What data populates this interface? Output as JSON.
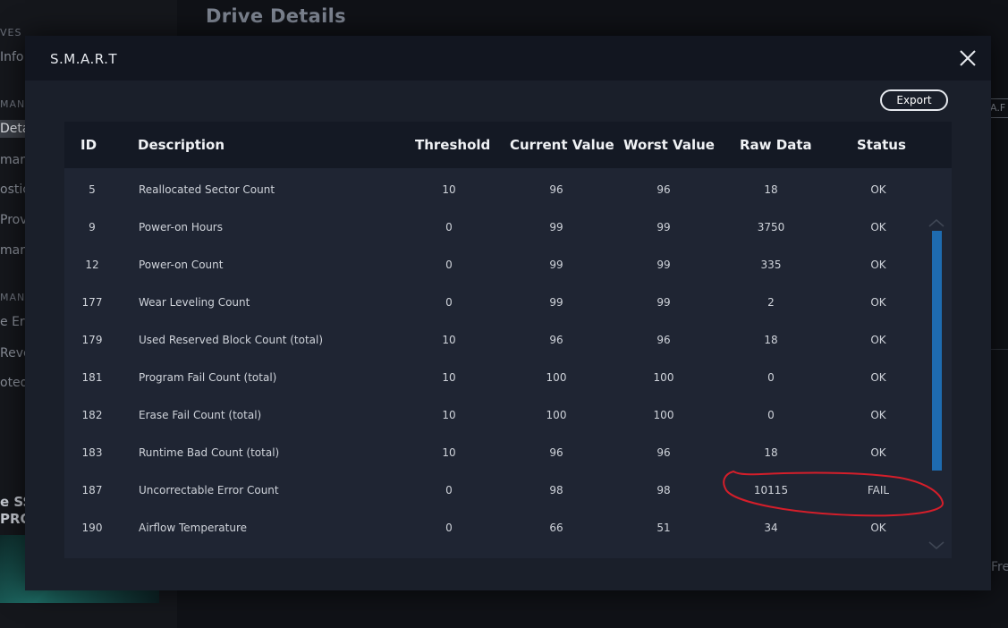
{
  "background": {
    "page_title": "Drive Details",
    "sidebar": {
      "fragments": [
        "VES",
        "Info",
        "MANA",
        "Deta",
        "mar",
        "ostic",
        "Prov",
        "mar",
        "MANA",
        "e Era",
        "Reve",
        "oted"
      ],
      "product_lines": [
        "e SS",
        "PRO"
      ]
    },
    "right_fragments": {
      "tab": "A.F",
      "text": "Fre"
    }
  },
  "modal": {
    "title": "S.M.A.R.T",
    "export_label": "Export",
    "columns": {
      "id": "ID",
      "description": "Description",
      "threshold": "Threshold",
      "current": "Current Value",
      "worst": "Worst Value",
      "raw": "Raw Data",
      "status": "Status"
    },
    "rows": [
      {
        "id": "5",
        "description": "Reallocated Sector Count",
        "threshold": "10",
        "current": "96",
        "worst": "96",
        "raw": "18",
        "status": "OK"
      },
      {
        "id": "9",
        "description": "Power-on Hours",
        "threshold": "0",
        "current": "99",
        "worst": "99",
        "raw": "3750",
        "status": "OK"
      },
      {
        "id": "12",
        "description": "Power-on Count",
        "threshold": "0",
        "current": "99",
        "worst": "99",
        "raw": "335",
        "status": "OK"
      },
      {
        "id": "177",
        "description": "Wear Leveling Count",
        "threshold": "0",
        "current": "99",
        "worst": "99",
        "raw": "2",
        "status": "OK"
      },
      {
        "id": "179",
        "description": "Used Reserved Block Count (total)",
        "threshold": "10",
        "current": "96",
        "worst": "96",
        "raw": "18",
        "status": "OK"
      },
      {
        "id": "181",
        "description": "Program Fail Count (total)",
        "threshold": "10",
        "current": "100",
        "worst": "100",
        "raw": "0",
        "status": "OK"
      },
      {
        "id": "182",
        "description": "Erase Fail Count (total)",
        "threshold": "10",
        "current": "100",
        "worst": "100",
        "raw": "0",
        "status": "OK"
      },
      {
        "id": "183",
        "description": "Runtime Bad Count (total)",
        "threshold": "10",
        "current": "96",
        "worst": "96",
        "raw": "18",
        "status": "OK"
      },
      {
        "id": "187",
        "description": "Uncorrectable Error Count",
        "threshold": "0",
        "current": "98",
        "worst": "98",
        "raw": "10115",
        "status": "FAIL"
      },
      {
        "id": "190",
        "description": "Airflow Temperature",
        "threshold": "0",
        "current": "66",
        "worst": "51",
        "raw": "34",
        "status": "OK"
      }
    ]
  },
  "colors": {
    "modal_bg": "#1a1f2a",
    "header_bg": "#121620",
    "scrollbar": "#1e6bb0",
    "annotation": "#d41e2a"
  },
  "icons": [
    "close-icon",
    "chevron-up-icon",
    "chevron-down-icon"
  ]
}
